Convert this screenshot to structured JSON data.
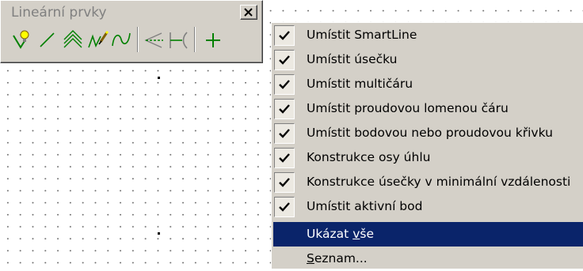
{
  "toolbar": {
    "title": "Lineární prvky",
    "close_label": "Close",
    "tools": [
      {
        "name": "smartline-tool-icon"
      },
      {
        "name": "line-tool-icon"
      },
      {
        "name": "multiline-tool-icon"
      },
      {
        "name": "stream-line-tool-icon"
      },
      {
        "name": "curve-tool-icon"
      },
      {
        "name": "angle-bisector-tool-icon"
      },
      {
        "name": "min-distance-tool-icon"
      },
      {
        "name": "active-point-tool-icon"
      }
    ]
  },
  "menu": {
    "items": [
      {
        "label": "Umístit SmartLine",
        "checked": true
      },
      {
        "label": "Umístit úsečku",
        "checked": true
      },
      {
        "label": "Umístit multičáru",
        "checked": true
      },
      {
        "label": "Umístit proudovou lomenou čáru",
        "checked": true
      },
      {
        "label": "Umístit bodovou nebo proudovou křivku",
        "checked": true
      },
      {
        "label": "Konstrukce osy úhlu",
        "checked": true
      },
      {
        "label": "Konstrukce úsečky v minimální vzdálenosti",
        "checked": true
      },
      {
        "label": "Umístit aktivní bod",
        "checked": true
      }
    ],
    "show_all": {
      "pre": "Ukázat ",
      "accel": "v",
      "post": "še"
    },
    "list": {
      "accel": "S",
      "post": "eznam..."
    }
  },
  "colors": {
    "face": "#d4d0c8",
    "highlight": "#0a246a",
    "icon_green": "#008000",
    "icon_yellow": "#ffff00"
  }
}
